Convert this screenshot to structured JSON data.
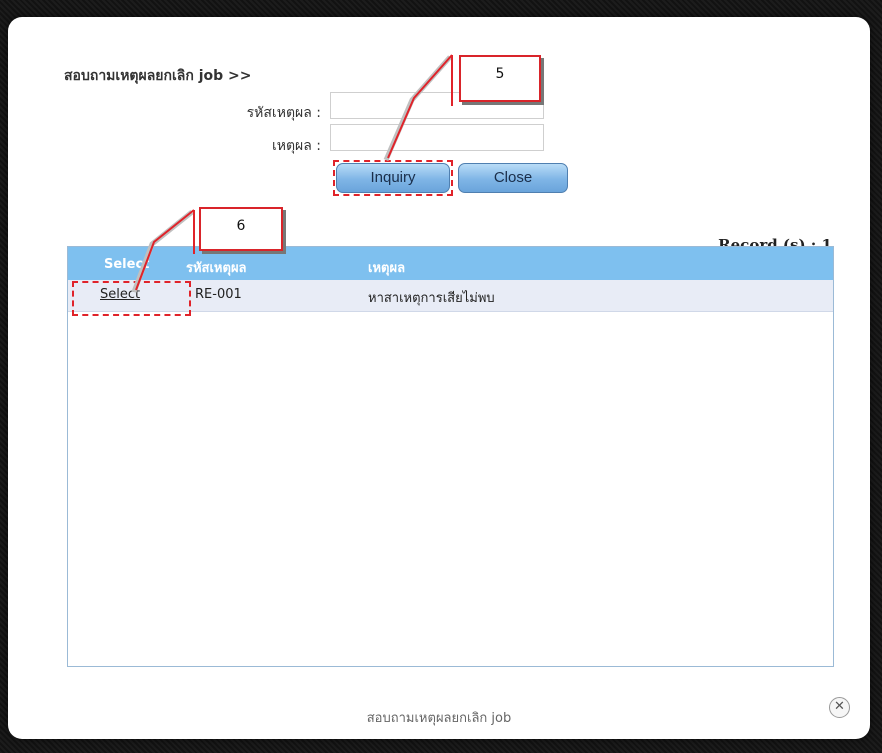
{
  "dialog": {
    "title": "สอบถามเหตุผลยกเลิก job >>",
    "footer_title": "สอบถามเหตุผลยกเลิก job",
    "close_glyph": "✕"
  },
  "form": {
    "code_label": "รหัสเหตุผล :",
    "code_value": "",
    "reason_label": "เหตุผล :",
    "reason_value": "",
    "inquiry_label": "Inquiry",
    "close_label": "Close"
  },
  "callouts": {
    "inquiry_step": "5",
    "select_step": "6"
  },
  "results": {
    "record_count": "Record (s) : 1",
    "columns": [
      "Select",
      "รหัสเหตุผล",
      "เหตุผล"
    ],
    "rows": [
      {
        "select": "Select",
        "code": "RE-001",
        "reason": "หาสาเหตุการเสียไม่พบ"
      }
    ]
  },
  "colors": {
    "accent": "#7ec0ef",
    "annotation": "#e0232a",
    "row_bg": "#e8ecf6"
  }
}
